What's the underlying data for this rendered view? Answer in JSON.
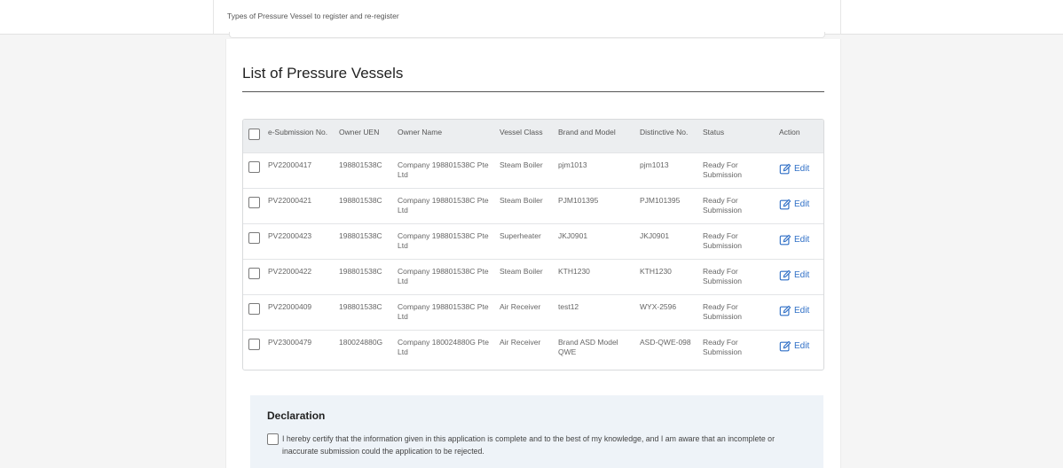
{
  "header": {
    "subtitle": "Types of Pressure Vessel to register and re-register"
  },
  "section": {
    "title": "List of Pressure Vessels"
  },
  "table": {
    "columns": [
      "e-Submission No.",
      "Owner UEN",
      "Owner Name",
      "Vessel Class",
      "Brand and Model",
      "Distinctive No.",
      "Status",
      "Action"
    ],
    "rows": [
      {
        "submission": "PV22000417",
        "uen": "198801538C",
        "owner": "Company 198801538C Pte Ltd",
        "vessel_class": "Steam Boiler",
        "brand": "pjm1013",
        "distinctive": "pjm1013",
        "status": "Ready For Submission",
        "action": "Edit"
      },
      {
        "submission": "PV22000421",
        "uen": "198801538C",
        "owner": "Company 198801538C Pte Ltd",
        "vessel_class": "Steam Boiler",
        "brand": "PJM101395",
        "distinctive": "PJM101395",
        "status": "Ready For Submission",
        "action": "Edit"
      },
      {
        "submission": "PV22000423",
        "uen": "198801538C",
        "owner": "Company 198801538C Pte Ltd",
        "vessel_class": "Superheater",
        "brand": "JKJ0901",
        "distinctive": "JKJ0901",
        "status": "Ready For Submission",
        "action": "Edit"
      },
      {
        "submission": "PV22000422",
        "uen": "198801538C",
        "owner": "Company 198801538C Pte Ltd",
        "vessel_class": "Steam Boiler",
        "brand": "KTH1230",
        "distinctive": "KTH1230",
        "status": "Ready For Submission",
        "action": "Edit"
      },
      {
        "submission": "PV22000409",
        "uen": "198801538C",
        "owner": "Company 198801538C Pte Ltd",
        "vessel_class": "Air Receiver",
        "brand": "test12",
        "distinctive": "WYX-2596",
        "status": "Ready For Submission",
        "action": "Edit"
      },
      {
        "submission": "PV23000479",
        "uen": "180024880G",
        "owner": "Company 180024880G Pte Ltd",
        "vessel_class": "Air Receiver",
        "brand": "Brand ASD Model QWE",
        "distinctive": "ASD-QWE-098",
        "status": "Ready For Submission",
        "action": "Edit"
      }
    ]
  },
  "declaration": {
    "title": "Declaration",
    "text": "I hereby certify that the information given in this application is complete and to the best of my knowledge, and I am aware that an incomplete or inaccurate submission could the application to be rejected."
  },
  "colors": {
    "link": "#2f6fc6",
    "header_bg": "#eceef0",
    "declaration_bg": "#eef3f8"
  },
  "icons": {
    "edit": "edit-icon",
    "checkbox": "checkbox"
  }
}
